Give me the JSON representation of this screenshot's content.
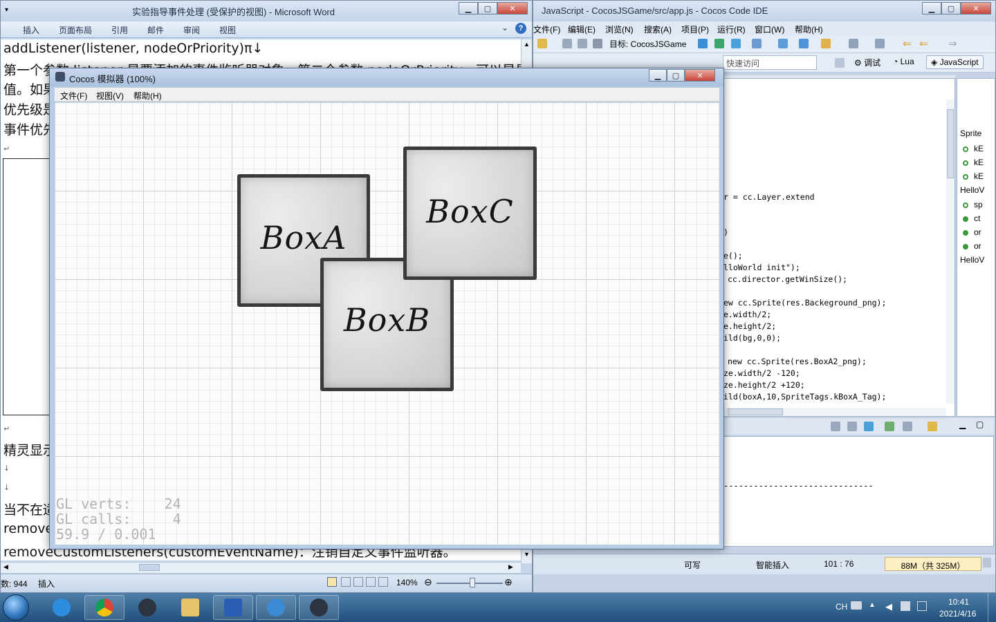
{
  "word": {
    "title": "实验指导事件处理 (受保护的视图) - Microsoft Word",
    "tabs": [
      "插入",
      "页面布局",
      "引用",
      "邮件",
      "审阅",
      "视图"
    ],
    "lines": [
      "addListener(listener, nodeOrPriority)π↓",
      "第一个参数 listener 是要添加的事件监听器对象，第二个参数 nodeOrPriority，可以是是",
      "值。如果",
      "优先级是",
      "事件优先",
      "↵",
      "↵",
      "精灵显示",
      "↓",
      "↓",
      "当不在适",
      "removeL",
      "removeCustomListeners(customEventName)：注销自定义事件监听器。"
    ],
    "status": {
      "words": "数: 944",
      "mode": "插入",
      "zoom": "140%"
    }
  },
  "ide": {
    "title": "JavaScript - CocosJSGame/src/app.js - Cocos Code IDE",
    "menus": [
      "文件(F)",
      "编辑(E)",
      "浏览(N)",
      "搜索(A)",
      "项目(P)",
      "运行(R)",
      "窗口(W)",
      "帮助(H)"
    ],
    "target_label": "目标: CocosJSGame",
    "quick_access": "快速访问",
    "perspectives": [
      "调试",
      "Lua",
      "JavaScript"
    ],
    "code_lines": [
      "r = cc.Layer.extend",
      ")",
      "e();",
      "lloWorld init\");",
      "cc.director.getWinSize();",
      "ew cc.Sprite(res.Backeground_png);",
      "e.width/2;",
      "e.height/2;",
      "ild(bg,0,0);",
      "new cc.Sprite(res.BoxA2_png);",
      "ze.width/2 -120;",
      "ze.height/2 +120;",
      "ild(boxA,10,SpriteTags.kBoxA_Tag);"
    ],
    "outline": {
      "header1": "Sprite",
      "items1": [
        "kE",
        "kE",
        "kE"
      ],
      "header2": "HelloV",
      "items2": [
        "sp",
        "ct",
        "or",
        "or"
      ],
      "header3": "HelloV"
    },
    "console_line": "------------------------------",
    "status": {
      "writable": "可写",
      "insert_mode": "智能插入",
      "position": "101 : 76",
      "memory": "88M（共 325M）"
    }
  },
  "simulator": {
    "title": "Cocos 模拟器 (100%)",
    "menus": [
      "文件(F)",
      "视图(V)",
      "帮助(H)"
    ],
    "boxes": [
      "BoxA",
      "BoxB",
      "BoxC"
    ],
    "gl_stats": [
      "GL verts:    24",
      "GL calls:     4",
      "59.9 / 0.001"
    ]
  },
  "taskbar": {
    "apps": [
      "start-orb",
      "internet-explorer",
      "chrome",
      "nox",
      "file-explorer",
      "word",
      "cocos-code-ide",
      "cocos-simulator"
    ],
    "lang": "CH",
    "time": "10:41",
    "date": "2021/4/16"
  }
}
